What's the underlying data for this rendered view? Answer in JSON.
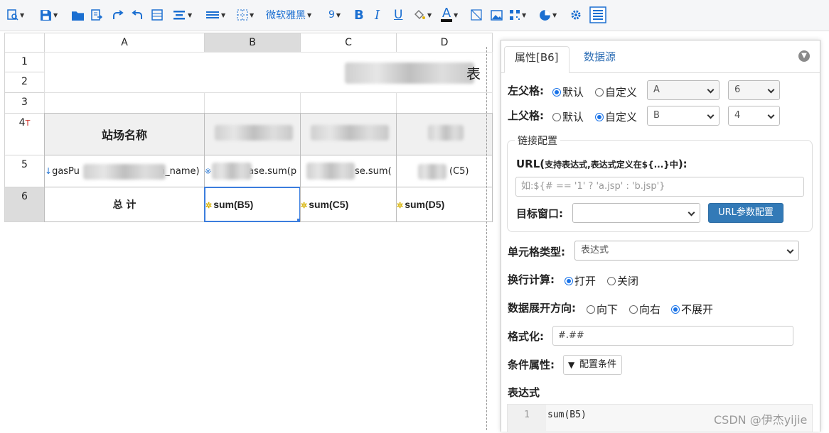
{
  "toolbar": {
    "font_name": "微软雅黑",
    "font_size": "9",
    "bold": "B",
    "italic": "I",
    "underline": "U",
    "font_color": "A",
    "items": [
      "preview-icon",
      "save-icon",
      "open-icon",
      "export-icon",
      "redo-icon",
      "undo-icon",
      "merge-icon",
      "align-center-icon",
      "line-style-icon",
      "border-icon",
      "font-select",
      "font-size-select",
      "bold-icon",
      "italic-icon",
      "underline-icon",
      "fill-color-icon",
      "font-color-icon",
      "diagonal-icon",
      "image-icon",
      "qrcode-icon",
      "chart-icon",
      "settings-icon",
      "properties-icon"
    ]
  },
  "grid": {
    "columns": [
      "A",
      "B",
      "C",
      "D"
    ],
    "rows": [
      "1",
      "2",
      "3",
      "4",
      "5",
      "6"
    ],
    "row4_marker": "T",
    "header_row": {
      "a": "站场名称"
    },
    "detail_row": {
      "a": "gasPu",
      "a_tail": "n_name)",
      "b": "ase.sum(p",
      "c": "se.sum(",
      "d": "(C5)"
    },
    "total_row": {
      "a": "总 计",
      "b": "sum(B5)",
      "c": "sum(C5)",
      "d": "sum(D5)"
    },
    "title_tail": "表"
  },
  "panel": {
    "tab_properties": "属性[B6]",
    "tab_datasource": "数据源",
    "left_parent": {
      "label": "左父格:",
      "opt_default": "默认",
      "opt_custom": "自定义",
      "selected": "default",
      "col": "A",
      "row": "6"
    },
    "top_parent": {
      "label": "上父格:",
      "opt_default": "默认",
      "opt_custom": "自定义",
      "selected": "custom",
      "col": "B",
      "row": "4"
    },
    "link": {
      "legend": "链接配置",
      "url_label": "URL(",
      "url_hint": "支持表达式,表达式定义在${...}中",
      "url_hint_end": "):",
      "url_placeholder": "如:${# == '1' ? 'a.jsp' : 'b.jsp'}",
      "target_label": "目标窗口:",
      "target_value": "",
      "param_button": "URL参数配置"
    },
    "cell_type": {
      "label": "单元格类型:",
      "value": "表达式"
    },
    "line_calc": {
      "label": "换行计算:",
      "opt_on": "打开",
      "opt_off": "关闭",
      "selected": "on"
    },
    "expand": {
      "label": "数据展开方向:",
      "opt_down": "向下",
      "opt_right": "向右",
      "opt_none": "不展开",
      "selected": "none"
    },
    "format": {
      "label": "格式化:",
      "value": "#.##"
    },
    "condition": {
      "label": "条件属性:",
      "button": "配置条件"
    },
    "expression": {
      "label": "表达式",
      "line_no": "1",
      "code": "sum(B5)"
    }
  },
  "watermark": "CSDN @伊杰yijie",
  "colors": {
    "accent": "#1b6fd1",
    "button_blue": "#337ab7",
    "selection": "#1a73e8"
  }
}
